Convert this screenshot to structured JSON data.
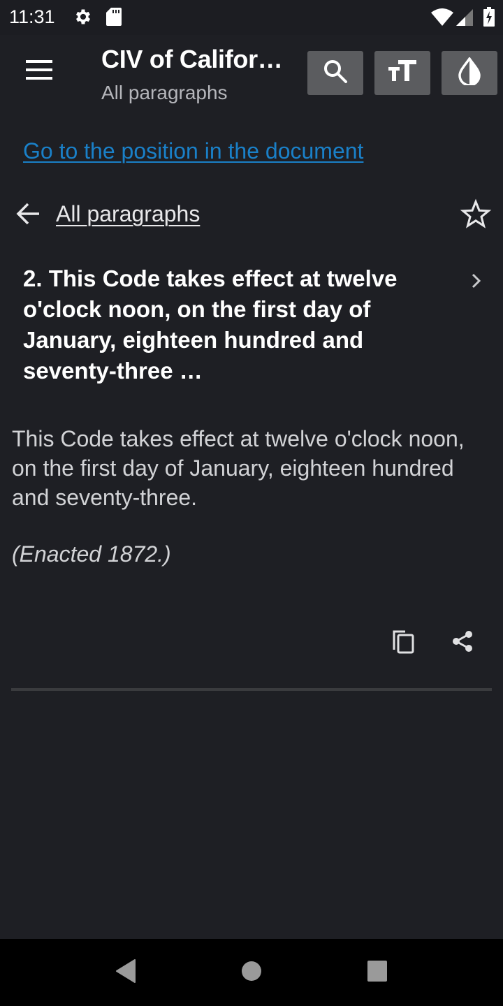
{
  "status_bar": {
    "time": "11:31",
    "left_icons": [
      "gear-icon",
      "sd-card-icon"
    ],
    "right_icons": [
      "wifi-icon",
      "cell-signal-icon",
      "battery-charging-icon"
    ]
  },
  "app_bar": {
    "title": "CIV of Califor…",
    "subtitle": "All paragraphs",
    "menu_icon": "hamburger-menu-icon",
    "actions": [
      {
        "name": "search",
        "icon": "search-icon"
      },
      {
        "name": "text-size",
        "icon": "text-size-icon"
      },
      {
        "name": "theme",
        "icon": "contrast-drop-icon"
      }
    ],
    "button_color": "#5b5c5f"
  },
  "content": {
    "goto_link": "Go to the position in the document",
    "goto_link_color": "#1a80c8",
    "back_link": "All paragraphs",
    "paragraph_heading": "2. This Code takes effect at twelve o'clock noon, on the first day of January, eighteen hundred and seventy-three …",
    "paragraph_body": "This Code takes effect at twelve o'clock noon, on the first day of January, eighteen hundred and seventy-three.",
    "paragraph_note": "(Enacted 1872.)",
    "actions": [
      "copy-icon",
      "share-icon"
    ]
  },
  "nav_bar": {
    "buttons": [
      "back",
      "home",
      "recents"
    ]
  },
  "colors": {
    "background": "#1e1f24",
    "text_primary": "#ffffff",
    "text_secondary": "#d2d3d6",
    "divider": "#3a3b3e"
  }
}
